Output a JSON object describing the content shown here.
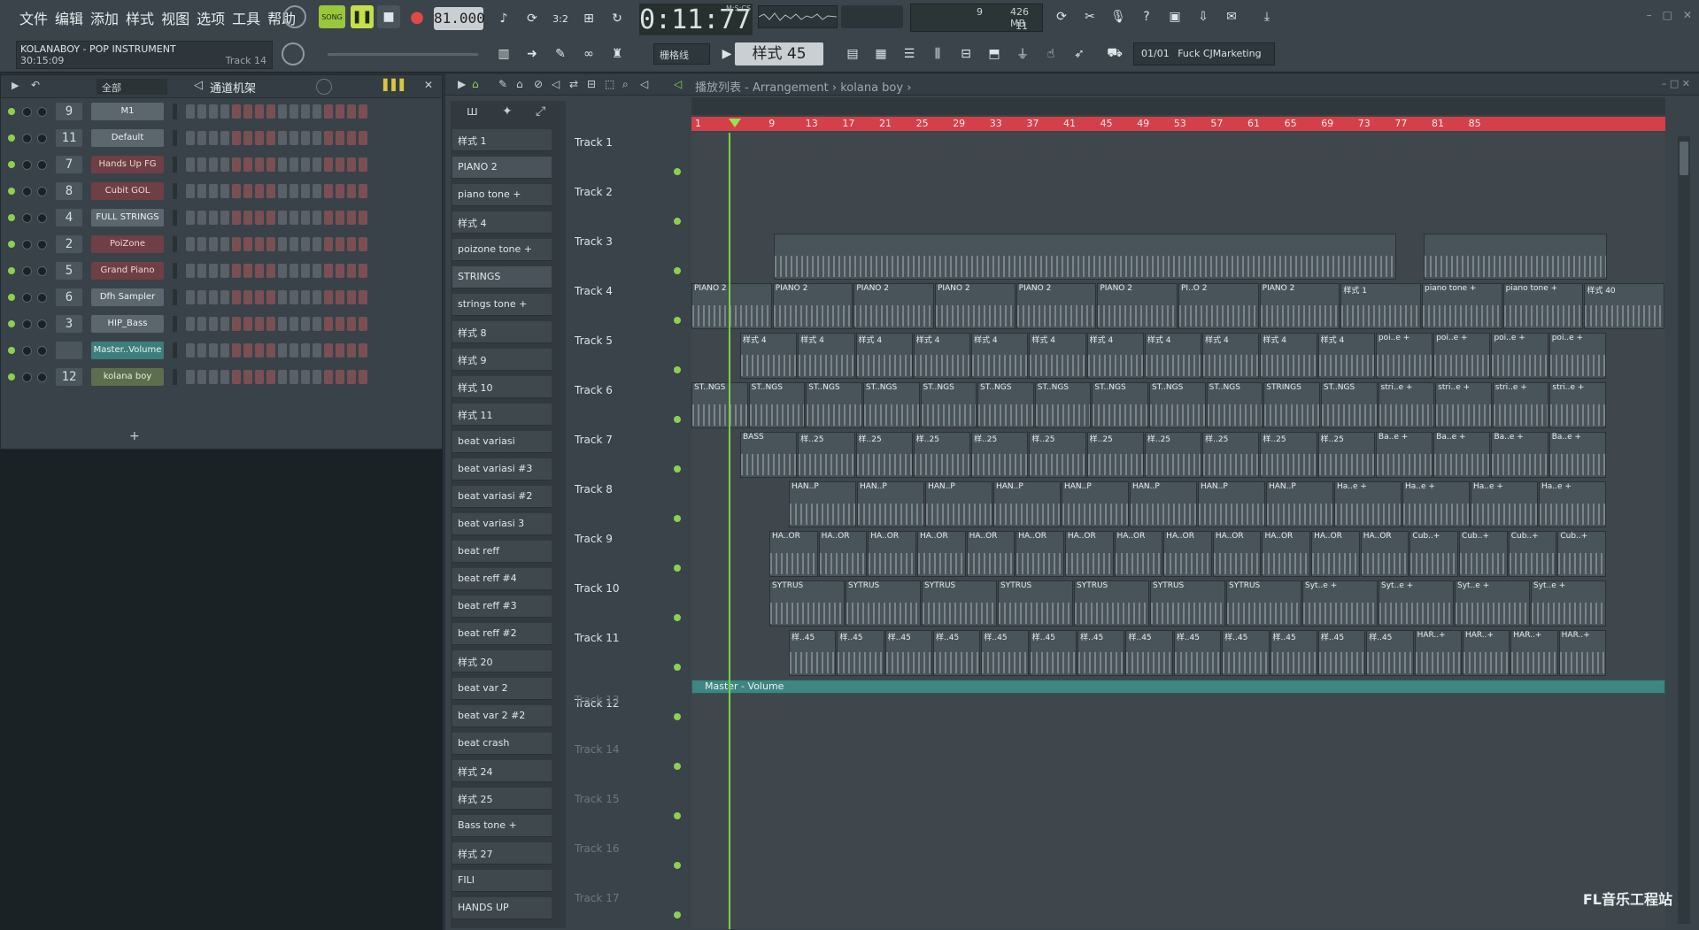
{
  "menu": [
    "文件",
    "编辑",
    "添加",
    "样式",
    "视图",
    "选项",
    "工具",
    "帮助"
  ],
  "transport": {
    "mode_label": "SONG",
    "tempo": "81.000",
    "clock": "0:11:77",
    "clock_unit": "M:S:CS"
  },
  "cpu": {
    "value": "9",
    "memory": "426 MB",
    "voices": "11"
  },
  "song_info": {
    "title": "KOLANABOY - POP INSTRUMENT",
    "time": "30:15:09",
    "track": "Track 14"
  },
  "toolbar2": {
    "snap": "栅格线",
    "pattern": "样式 45"
  },
  "hint_bar": {
    "index": "01/01",
    "text": "Fuck CJMarketing"
  },
  "channel_rack": {
    "filter": "全部",
    "title": "通道机架",
    "channels": [
      {
        "num": "9",
        "name": "M1",
        "style": "gray"
      },
      {
        "num": "11",
        "name": "Default",
        "style": "gray"
      },
      {
        "num": "7",
        "name": "Hands Up FG",
        "style": "red"
      },
      {
        "num": "8",
        "name": "Cubit GOL",
        "style": "red"
      },
      {
        "num": "4",
        "name": "FULL STRINGS",
        "style": "gray"
      },
      {
        "num": "2",
        "name": "PoiZone",
        "style": "red"
      },
      {
        "num": "5",
        "name": "Grand Piano",
        "style": "red"
      },
      {
        "num": "6",
        "name": "Dfh Sampler",
        "style": "gray"
      },
      {
        "num": "3",
        "name": "HIP_Bass",
        "style": "gray"
      },
      {
        "num": "",
        "name": "Master..Volume",
        "style": "teal"
      },
      {
        "num": "12",
        "name": "kolana boy",
        "style": "green"
      }
    ],
    "add_button": "+"
  },
  "playlist": {
    "title": "播放列表 - Arrangement › kolana boy ›",
    "patterns": [
      "样式 1",
      "PIANO 2",
      "piano tone +",
      "样式 4",
      "poizone tone +",
      "STRINGS",
      "strings tone +",
      "样式 8",
      "样式 9",
      "样式 10",
      "样式 11",
      "beat variasi",
      "beat variasi #3",
      "beat variasi #2",
      "beat variasi 3",
      "beat reff",
      "beat reff #4",
      "beat reff #3",
      "beat reff #2",
      "样式 20",
      "beat var 2",
      "beat var 2 #2",
      "beat crash",
      "样式 24",
      "样式 25",
      "Bass tone +",
      "样式 27",
      "FILI",
      "HANDS UP"
    ],
    "tracks": [
      "Track 1",
      "Track 2",
      "Track 3",
      "Track 4",
      "Track 5",
      "Track 6",
      "Track 7",
      "Track 8",
      "Track 9",
      "Track 10",
      "Track 11",
      "Track 12",
      "Track 13",
      "Track 14",
      "Track 15",
      "Track 16",
      "Track 17"
    ],
    "ruler": [
      "1",
      "9",
      "13",
      "17",
      "21",
      "25",
      "29",
      "33",
      "37",
      "41",
      "45",
      "49",
      "53",
      "57",
      "61",
      "65",
      "69",
      "73",
      "77",
      "81",
      "85"
    ],
    "clip_labels": {
      "track4": [
        "PIANO 2",
        "PIANO 2",
        "PIANO 2",
        "PIANO 2",
        "PIANO 2",
        "PIANO 2",
        "PI..O 2",
        "PIANO 2",
        "样式 1",
        "piano tone +",
        "piano tone +",
        "样式 40"
      ],
      "track5": [
        "样式 4",
        "样式 4",
        "样式 4",
        "样式 4",
        "样式 4",
        "样式 4",
        "样式 4",
        "样式 4",
        "样式 4",
        "样式 4",
        "样式 4",
        "poi..e +",
        "poi..e +",
        "poi..e +",
        "poi..e +"
      ],
      "track6": [
        "ST..NGS",
        "ST..NGS",
        "ST..NGS",
        "ST..NGS",
        "ST..NGS",
        "ST..NGS",
        "ST..NGS",
        "ST..NGS",
        "ST..NGS",
        "ST..NGS",
        "STRINGS",
        "ST..NGS",
        "stri..e +",
        "stri..e +",
        "stri..e +",
        "stri..e +"
      ],
      "track7": [
        "BASS",
        "样..25",
        "样..25",
        "样..25",
        "样..25",
        "样..25",
        "样..25",
        "样..25",
        "样..25",
        "样..25",
        "样..25",
        "Ba..e +",
        "Ba..e +",
        "Ba..e +",
        "Ba..e +"
      ],
      "track8": [
        "HAN..P",
        "HAN..P",
        "HAN..P",
        "HAN..P",
        "HAN..P",
        "HAN..P",
        "HAN..P",
        "HAN..P",
        "Ha..e +",
        "Ha..e +",
        "Ha..e +",
        "Ha..e +"
      ],
      "track9": [
        "HA..OR",
        "HA..OR",
        "HA..OR",
        "HA..OR",
        "HA..OR",
        "HA..OR",
        "HA..OR",
        "HA..OR",
        "HA..OR",
        "HA..OR",
        "HA..OR",
        "HA..OR",
        "HA..OR",
        "Cub..+",
        "Cub..+",
        "Cub..+",
        "Cub..+"
      ],
      "track10": [
        "SYTRUS",
        "SYTRUS",
        "SYTRUS",
        "SYTRUS",
        "SYTRUS",
        "SYTRUS",
        "SYTRUS",
        "Syt..e +",
        "Syt..e +",
        "Syt..e +",
        "Syt..e +"
      ],
      "track11": [
        "样..45",
        "样..45",
        "样..45",
        "样..45",
        "样..45",
        "样..45",
        "样..45",
        "样..45",
        "样..45",
        "样..45",
        "样..45",
        "样..45",
        "样..45",
        "HAR..+",
        "HAR..+",
        "HAR..+",
        "HAR..+"
      ],
      "track12": "Master - Volume"
    }
  },
  "watermark": "FL音乐工程站",
  "colors": {
    "ruler": "#d4404a",
    "playhead": "#7bd13e",
    "automation": "#3f8582",
    "background": "#3a4349"
  }
}
